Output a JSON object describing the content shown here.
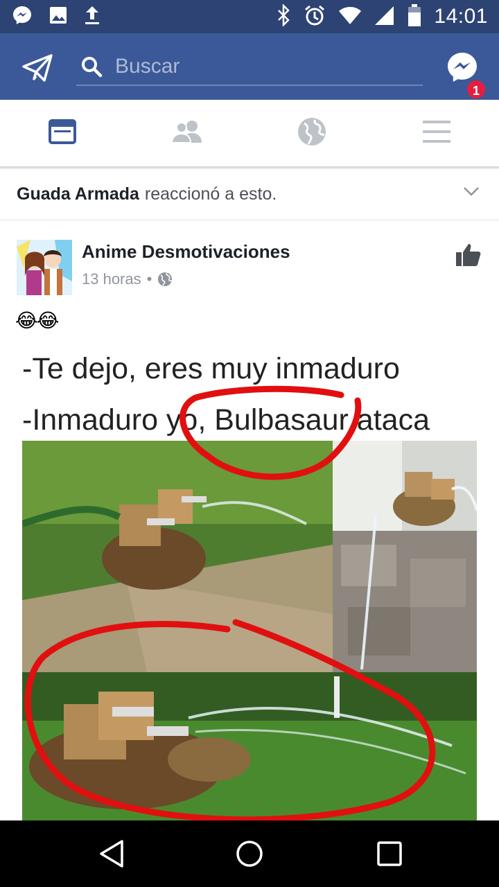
{
  "status_bar": {
    "time": "14:01",
    "left_icons": [
      "messenger-notification-icon",
      "image-icon",
      "upload-icon"
    ],
    "right_icons": [
      "bluetooth-icon",
      "alarm-icon",
      "wifi-icon",
      "signal-icon",
      "battery-icon"
    ]
  },
  "header": {
    "search_placeholder": "Buscar",
    "messenger_badge": "1",
    "background": "#3b5998"
  },
  "tabs": [
    {
      "name": "news-feed",
      "icon": "news-feed-icon",
      "active": true
    },
    {
      "name": "friends",
      "icon": "friends-icon",
      "active": false
    },
    {
      "name": "notifications",
      "icon": "globe-icon",
      "active": false
    },
    {
      "name": "menu",
      "icon": "menu-icon",
      "active": false
    }
  ],
  "story": {
    "actor": "Guada Armada",
    "action": "reaccionó a esto.",
    "page_name": "Anime Desmotivaciones",
    "time": "13 horas",
    "separator": "•",
    "body": "😂😂",
    "meme_line_1": "-Te dejo, eres muy inmaduro",
    "meme_line_2": "-Inmaduro yo, Bulbasaur ataca"
  },
  "nav": {
    "icons": [
      "back-icon",
      "home-icon",
      "recents-icon"
    ]
  }
}
